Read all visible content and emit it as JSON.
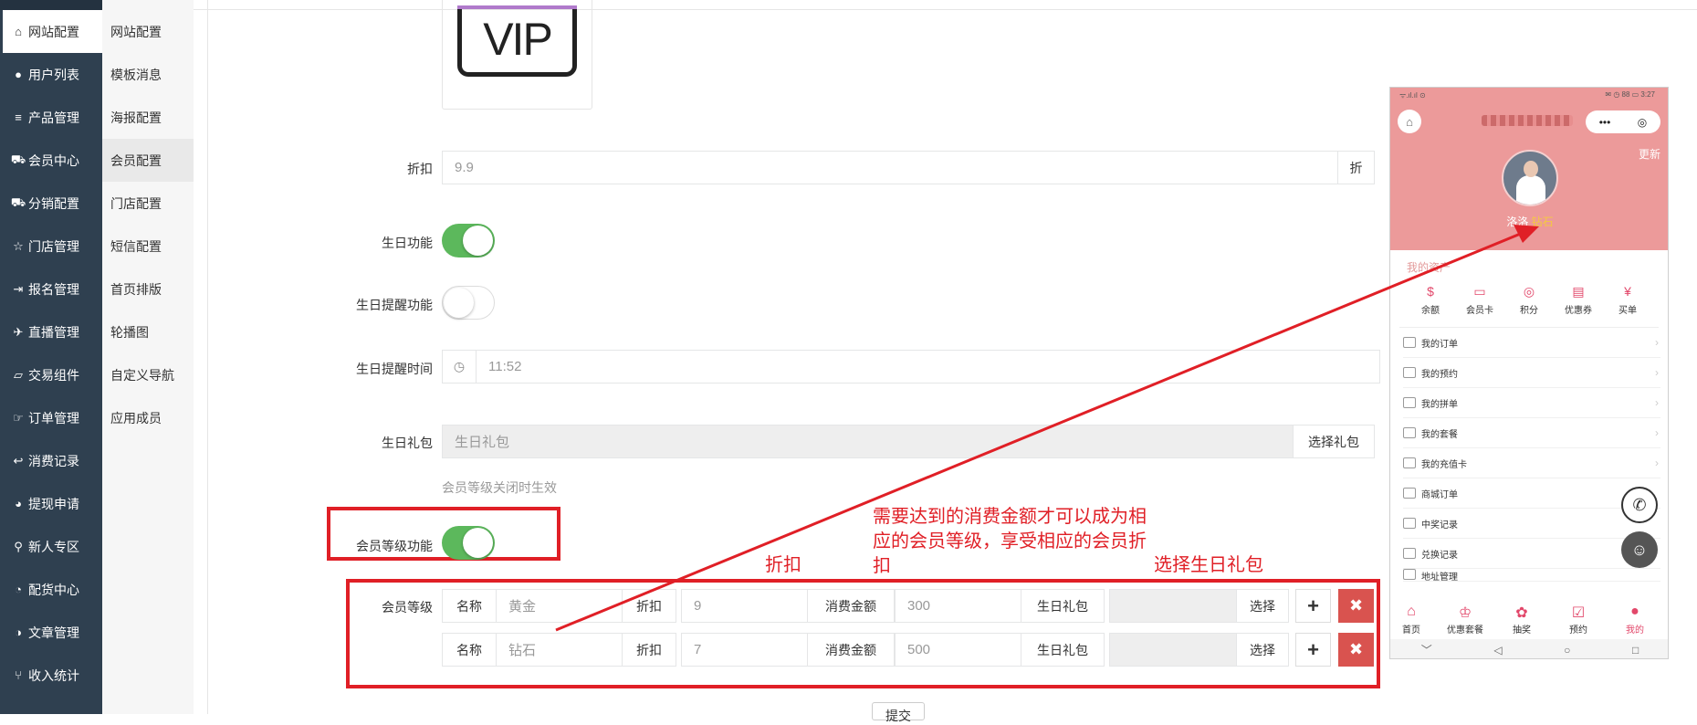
{
  "nav": {
    "items": [
      {
        "icon": "home-icon",
        "glyph": "⌂",
        "label": "网站配置"
      },
      {
        "icon": "user-icon",
        "glyph": "●",
        "label": "用户列表"
      },
      {
        "icon": "server-icon",
        "glyph": "≡",
        "label": "产品管理"
      },
      {
        "icon": "cart-icon",
        "glyph": "⛟",
        "label": "会员中心"
      },
      {
        "icon": "cart-icon",
        "glyph": "⛟",
        "label": "分销配置"
      },
      {
        "icon": "star-icon",
        "glyph": "☆",
        "label": "门店管理"
      },
      {
        "icon": "sign-in-icon",
        "glyph": "⇥",
        "label": "报名管理"
      },
      {
        "icon": "plane-icon",
        "glyph": "✈",
        "label": "直播管理"
      },
      {
        "icon": "eraser-icon",
        "glyph": "▱",
        "label": "交易组件"
      },
      {
        "icon": "hand-icon",
        "glyph": "☞",
        "label": "订单管理"
      },
      {
        "icon": "reply-icon",
        "glyph": "↩",
        "label": "消费记录"
      },
      {
        "icon": "wechat-icon",
        "glyph": "◕",
        "label": "提现申请"
      },
      {
        "icon": "map-marker-icon",
        "glyph": "⚲",
        "label": "新人专区"
      },
      {
        "icon": "pie-chart-icon",
        "glyph": "◔",
        "label": "配货中心"
      },
      {
        "icon": "adjust-icon",
        "glyph": "◑",
        "label": "文章管理"
      },
      {
        "icon": "code-fork-icon",
        "glyph": "⑂",
        "label": "收入统计"
      }
    ]
  },
  "subnav": {
    "items": [
      "网站配置",
      "模板消息",
      "海报配置",
      "会员配置",
      "门店配置",
      "短信配置",
      "首页排版",
      "轮播图",
      "自定义导航",
      "应用成员"
    ]
  },
  "form": {
    "vip_logo_text": "VIP",
    "discount_label": "折扣",
    "discount_value": "9.9",
    "discount_unit": "折",
    "birthday_label": "生日功能",
    "birthday_enabled": true,
    "birthday_remind_label": "生日提醒功能",
    "birthday_remind_enabled": false,
    "birthday_time_label": "生日提醒时间",
    "birthday_time_value": "11:52",
    "birthday_gift_label": "生日礼包",
    "birthday_gift_placeholder": "生日礼包",
    "birthday_gift_button": "选择礼包",
    "level_hint": "会员等级关闭时生效",
    "level_switch_label": "会员等级功能",
    "level_enabled": true,
    "level_rows_label": "会员等级",
    "level_rows": [
      {
        "name_label": "名称",
        "name": "黄金",
        "discount_label": "折扣",
        "discount": "9",
        "amount_label": "消费金额",
        "amount": "300",
        "gift_label": "生日礼包",
        "gift": "",
        "choose": "选择",
        "add": "+",
        "del": "✖"
      },
      {
        "name_label": "名称",
        "name": "钻石",
        "discount_label": "折扣",
        "discount": "7",
        "amount_label": "消费金额",
        "amount": "500",
        "gift_label": "生日礼包",
        "gift": "",
        "choose": "选择",
        "add": "+",
        "del": "✖"
      }
    ],
    "submit_label": "提交"
  },
  "annotations": {
    "discount": "折扣",
    "amount": "需要达到的消费金额才可以成为相应的会员等级，享受相应的会员折扣",
    "gift": "选择生日礼包"
  },
  "phone": {
    "status_left": "ᯤ.ıl.ıl ⊙",
    "status_right": "✉ ◷ 88 ▭ 3:27",
    "capsule_dots": "•••",
    "capsule_target": "◎",
    "update": "更新",
    "user_name": "洛洛",
    "user_level": "钻石",
    "assets_title": "我的资产",
    "asset_icons": [
      "余额",
      "会员卡",
      "积分",
      "优惠券",
      "买单"
    ],
    "menu": [
      "我的订单",
      "我的预约",
      "我的拼单",
      "我的套餐",
      "我的充值卡",
      "商城订单",
      "中奖记录",
      "兑换记录",
      "地址管理"
    ],
    "tabs": [
      "首页",
      "优惠套餐",
      "抽奖",
      "预约",
      "我的"
    ],
    "navbar": [
      "﹀",
      "◁",
      "○",
      "□"
    ]
  },
  "colors": {
    "nav_bg": "#2f4050",
    "toggle_on": "#5cb85c",
    "annotation_red": "#e01f26",
    "delete_red": "#d9534f",
    "phone_header": "#ec9a9a"
  }
}
